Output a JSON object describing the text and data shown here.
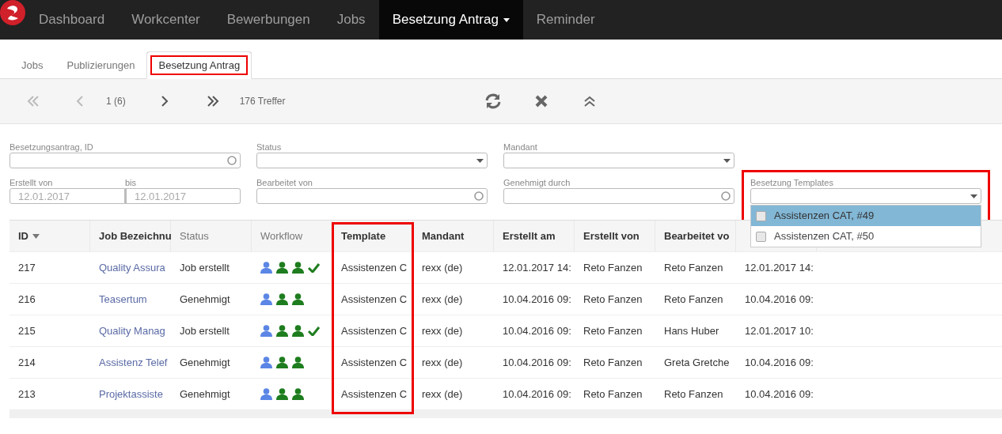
{
  "navbar": {
    "items": [
      {
        "label": "Dashboard",
        "selected": false,
        "dropdown": false
      },
      {
        "label": "Workcenter",
        "selected": false,
        "dropdown": false
      },
      {
        "label": "Bewerbungen",
        "selected": false,
        "dropdown": false
      },
      {
        "label": "Jobs",
        "selected": false,
        "dropdown": false
      },
      {
        "label": "Besetzung Antrag",
        "selected": true,
        "dropdown": true
      },
      {
        "label": "Reminder",
        "selected": false,
        "dropdown": false
      }
    ]
  },
  "tabs": [
    {
      "label": "Jobs",
      "selected": false,
      "highlighted": false
    },
    {
      "label": "Publizierungen",
      "selected": false,
      "highlighted": false
    },
    {
      "label": "Besetzung Antrag",
      "selected": true,
      "highlighted": true
    }
  ],
  "toolbar": {
    "page": "1 (6)",
    "hits": "176 Treffer",
    "first_disabled": true,
    "prev_disabled": true
  },
  "filters": [
    {
      "kind": "search",
      "label": "Besetzungsantrag, ID"
    },
    {
      "kind": "select",
      "label": "Status"
    },
    {
      "kind": "select",
      "label": "Mandant"
    },
    {
      "kind": "empty"
    },
    {
      "kind": "daterange",
      "label": "Erstellt von",
      "label2": "bis",
      "placeholder": "12.01.2017",
      "placeholder2": "12.01.2017"
    },
    {
      "kind": "search",
      "label": "Bearbeitet von"
    },
    {
      "kind": "search",
      "label": "Genehmigt durch"
    },
    {
      "kind": "select",
      "label": "Besetzung Templates",
      "highlighted": true,
      "expanded": true,
      "options": [
        {
          "label": "Assistenzen CAT, #49",
          "selected": true,
          "checked": false
        },
        {
          "label": "Assistenzen CAT, #50",
          "selected": false,
          "checked": false
        }
      ]
    }
  ],
  "table": {
    "columns": [
      {
        "label": "ID",
        "sorted": true
      },
      {
        "label": "Job Bezeichnu"
      },
      {
        "label": "Status"
      },
      {
        "label": "Workflow"
      },
      {
        "label": "Template",
        "highlighted": true
      },
      {
        "label": "Mandant"
      },
      {
        "label": "Erstellt am"
      },
      {
        "label": "Erstellt von"
      },
      {
        "label": "Bearbeitet vo"
      }
    ],
    "rows": [
      {
        "id": "217",
        "job": "Quality Assura",
        "status": "Job erstellt",
        "workflow": [
          {
            "kind": "person",
            "done": false
          },
          {
            "kind": "person",
            "done": true
          },
          {
            "kind": "person",
            "done": true
          },
          {
            "kind": "check"
          }
        ],
        "template": "Assistenzen C",
        "mandant": "rexx (de)",
        "created": "12.01.2017 14:",
        "creator": "Reto Fanzen",
        "editor": "Reto Fanzen",
        "edited": "12.01.2017 14:"
      },
      {
        "id": "216",
        "job": "Teasertum",
        "status": "Genehmigt",
        "workflow": [
          {
            "kind": "person",
            "done": false
          },
          {
            "kind": "person",
            "done": true
          },
          {
            "kind": "person",
            "done": true
          }
        ],
        "template": "Assistenzen C",
        "mandant": "rexx (de)",
        "created": "10.04.2016 09:",
        "creator": "Reto Fanzen",
        "editor": "Reto Fanzen",
        "edited": "10.04.2016 09:"
      },
      {
        "id": "215",
        "job": "Quality Manag",
        "status": "Job erstellt",
        "workflow": [
          {
            "kind": "person",
            "done": false
          },
          {
            "kind": "person",
            "done": true
          },
          {
            "kind": "person",
            "done": true
          },
          {
            "kind": "check"
          }
        ],
        "template": "Assistenzen C",
        "mandant": "rexx (de)",
        "created": "10.04.2016 09:",
        "creator": "Reto Fanzen",
        "editor": "Hans Huber",
        "edited": "12.01.2017 10:"
      },
      {
        "id": "214",
        "job": "Assistenz Telef",
        "status": "Genehmigt",
        "workflow": [
          {
            "kind": "person",
            "done": false
          },
          {
            "kind": "person",
            "done": true
          },
          {
            "kind": "person",
            "done": true
          }
        ],
        "template": "Assistenzen C",
        "mandant": "rexx (de)",
        "created": "10.04.2016 09:",
        "creator": "Reto Fanzen",
        "editor": "Greta Gretche",
        "edited": "10.04.2016 09:"
      },
      {
        "id": "213",
        "job": "Projektassiste",
        "status": "Genehmigt",
        "workflow": [
          {
            "kind": "person",
            "done": false
          },
          {
            "kind": "person",
            "done": true
          },
          {
            "kind": "person",
            "done": true
          }
        ],
        "template": "Assistenzen C",
        "mandant": "rexx (de)",
        "created": "10.04.2016 09:",
        "creator": "Reto Fanzen",
        "editor": "Reto Fanzen",
        "edited": "10.04.2016 09:"
      }
    ]
  }
}
